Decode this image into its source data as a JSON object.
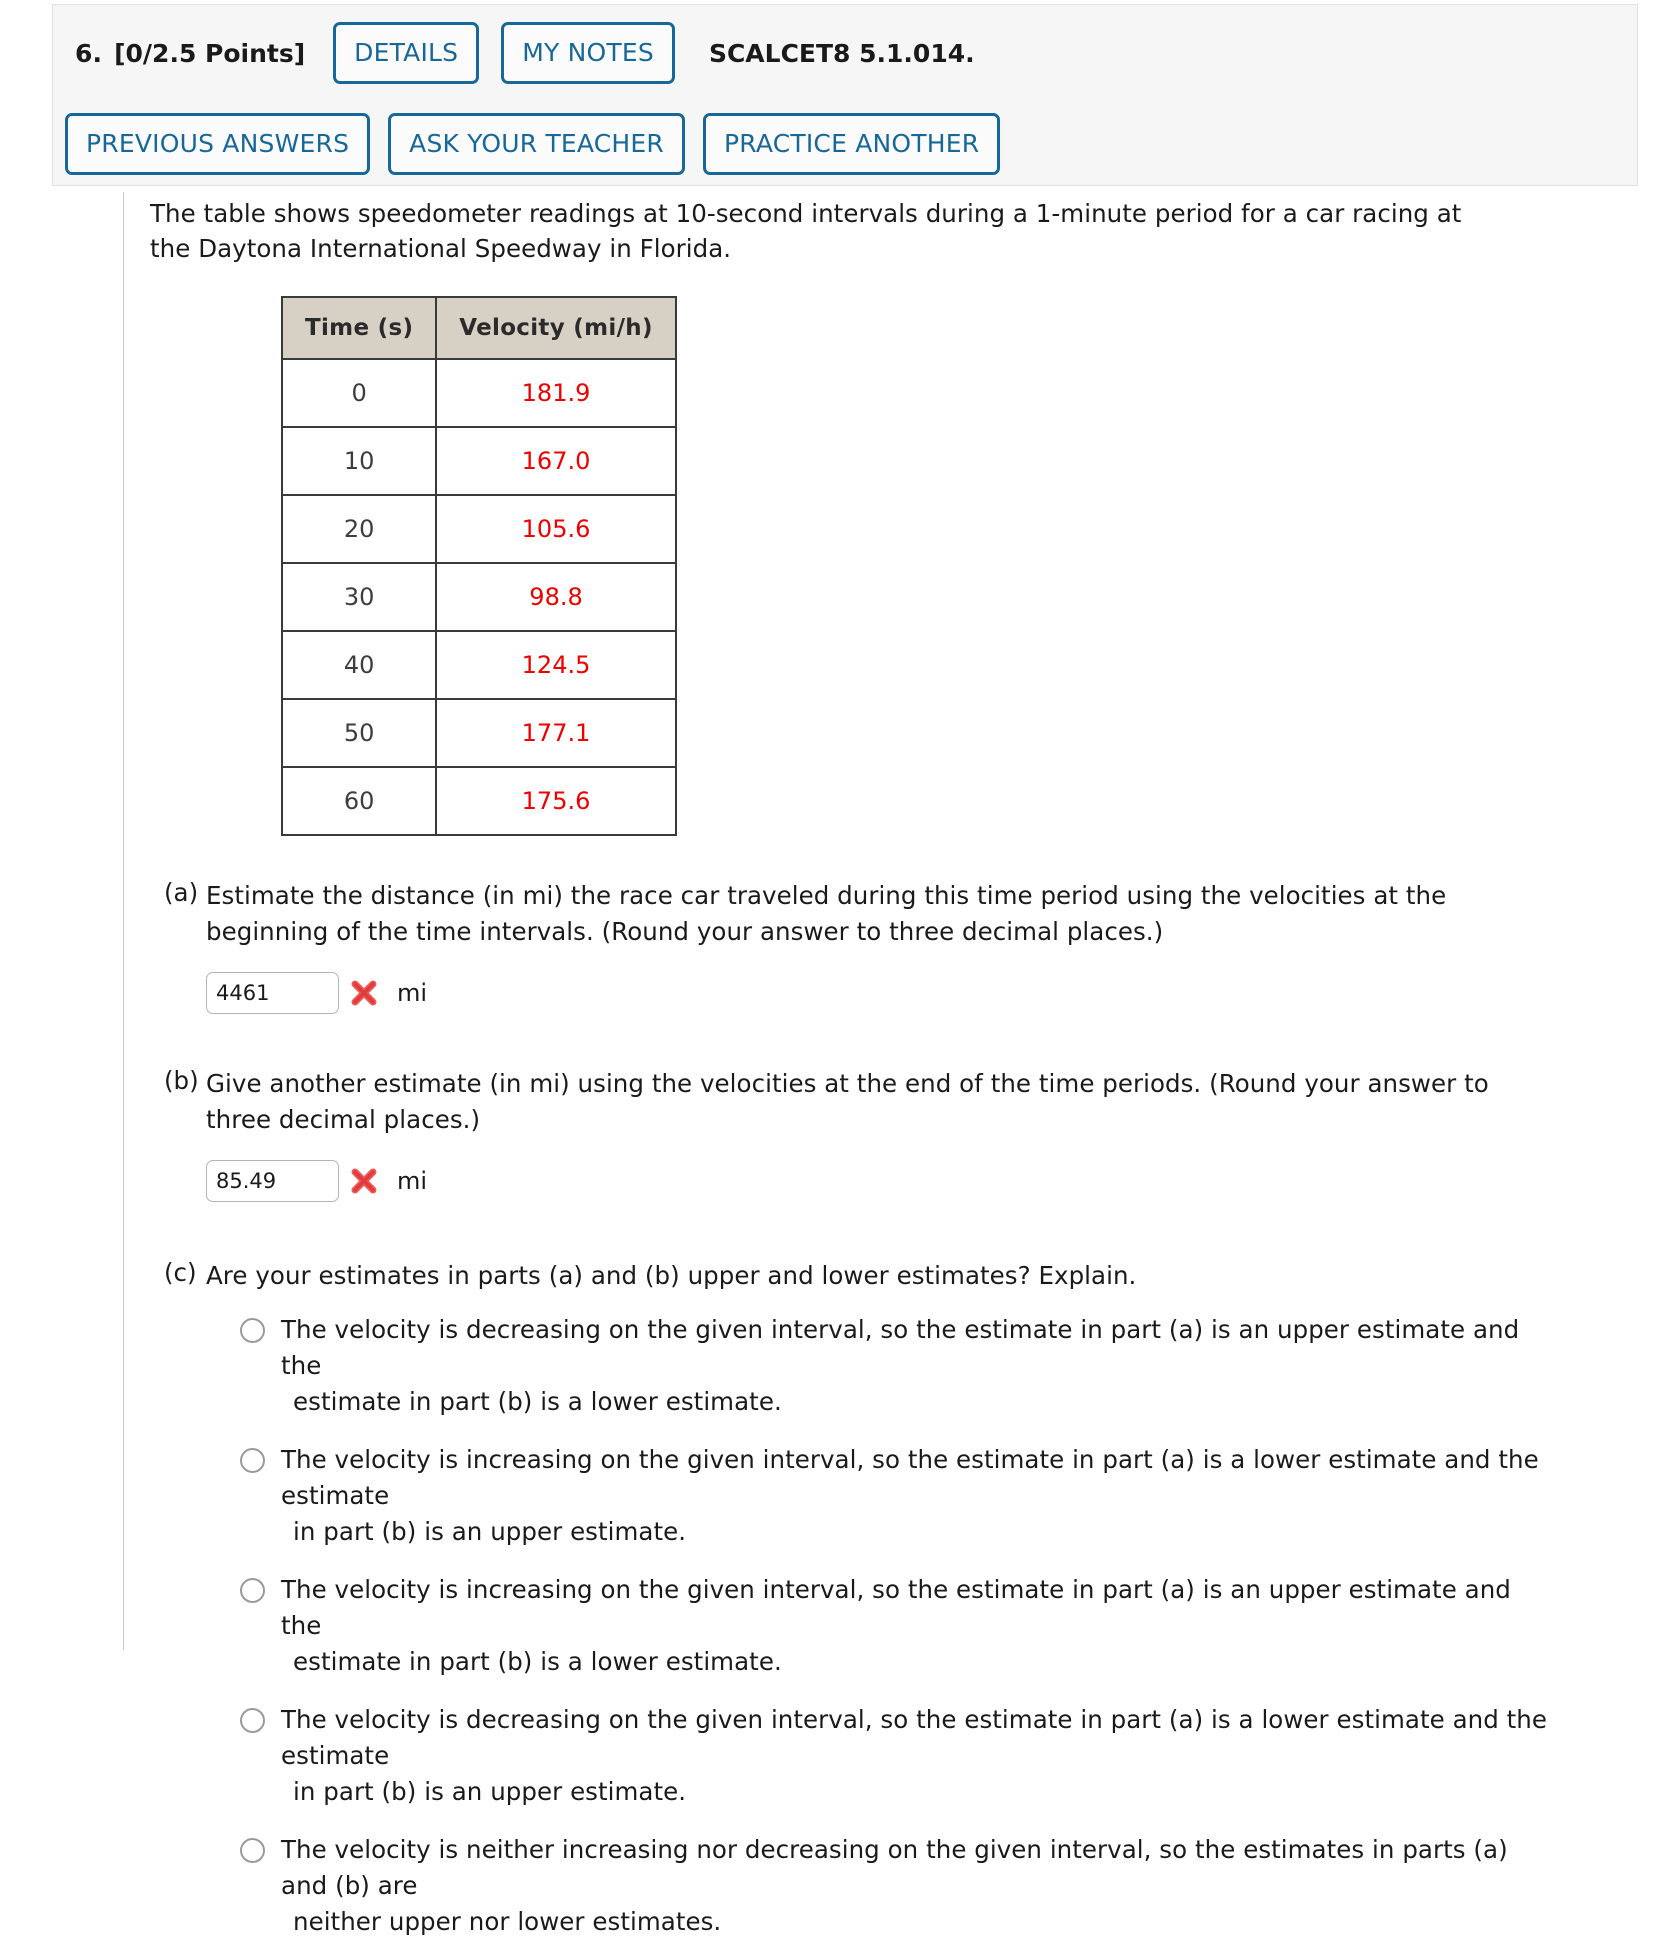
{
  "header": {
    "question_number": "6.",
    "points": "[0/2.5 Points]",
    "details_label": "DETAILS",
    "my_notes_label": "MY NOTES",
    "textbook_code": "SCALCET8 5.1.014.",
    "previous_answers_label": "PREVIOUS ANSWERS",
    "ask_your_teacher_label": "ASK YOUR TEACHER",
    "practice_another_label": "PRACTICE ANOTHER",
    "accent_color": "#176899",
    "panel_bg": "#f6f6f6"
  },
  "problem": {
    "intro": "The table shows speedometer readings at 10-second intervals during a 1-minute period for a car racing at the Daytona International Speedway in Florida."
  },
  "chart_data": {
    "type": "table",
    "title": "Speedometer readings at 10-second intervals",
    "columns": [
      "Time (s)",
      "Velocity (mi/h)"
    ],
    "xlabel": "Time (s)",
    "ylabel": "Velocity (mi/h)",
    "x": [
      0,
      10,
      20,
      30,
      40,
      50,
      60
    ],
    "values": [
      181.9,
      167.0,
      105.6,
      98.8,
      124.5,
      177.1,
      175.6
    ],
    "rows": [
      {
        "time": "0",
        "velocity": "181.9"
      },
      {
        "time": "10",
        "velocity": "167.0"
      },
      {
        "time": "20",
        "velocity": "105.6"
      },
      {
        "time": "30",
        "velocity": "98.8"
      },
      {
        "time": "40",
        "velocity": "124.5"
      },
      {
        "time": "50",
        "velocity": "177.1"
      },
      {
        "time": "60",
        "velocity": "175.6"
      }
    ],
    "header_bg": "#d6d1c4",
    "value_color": "#ee0000"
  },
  "parts": {
    "a": {
      "label": "(a)",
      "text": "Estimate the distance (in mi) the race car traveled during this time period using the velocities at the beginning of the time intervals. (Round your answer to three decimal places.)",
      "answer_value": "4461",
      "unit": "mi",
      "status": "incorrect"
    },
    "b": {
      "label": "(b)",
      "text": "Give another estimate (in mi) using the velocities at the end of the time periods. (Round your answer to three decimal places.)",
      "answer_value": "85.49",
      "unit": "mi",
      "status": "incorrect"
    },
    "c": {
      "label": "(c)",
      "text": "Are your estimates in parts (a) and (b) upper and lower estimates? Explain.",
      "options": [
        {
          "line1": "The velocity is decreasing on the given interval, so the estimate in part (a) is an upper estimate and the",
          "line2": "estimate in part (b) is a lower estimate.",
          "selected": false
        },
        {
          "line1": "The velocity is increasing on the given interval, so the estimate in part (a) is a lower estimate and the estimate",
          "line2": "in part (b) is an upper estimate.",
          "selected": false
        },
        {
          "line1": "The velocity is increasing on the given interval, so the estimate in part (a) is an upper estimate and the",
          "line2": "estimate in part (b) is a lower estimate.",
          "selected": false
        },
        {
          "line1": "The velocity is decreasing on the given interval, so the estimate in part (a) is a lower estimate and the estimate",
          "line2": "in part (b) is an upper estimate.",
          "selected": false
        },
        {
          "line1": "The velocity is neither increasing nor decreasing on the given interval, so the estimates in parts (a) and (b) are",
          "line2": "neither upper nor lower estimates.",
          "selected": false
        }
      ]
    }
  }
}
